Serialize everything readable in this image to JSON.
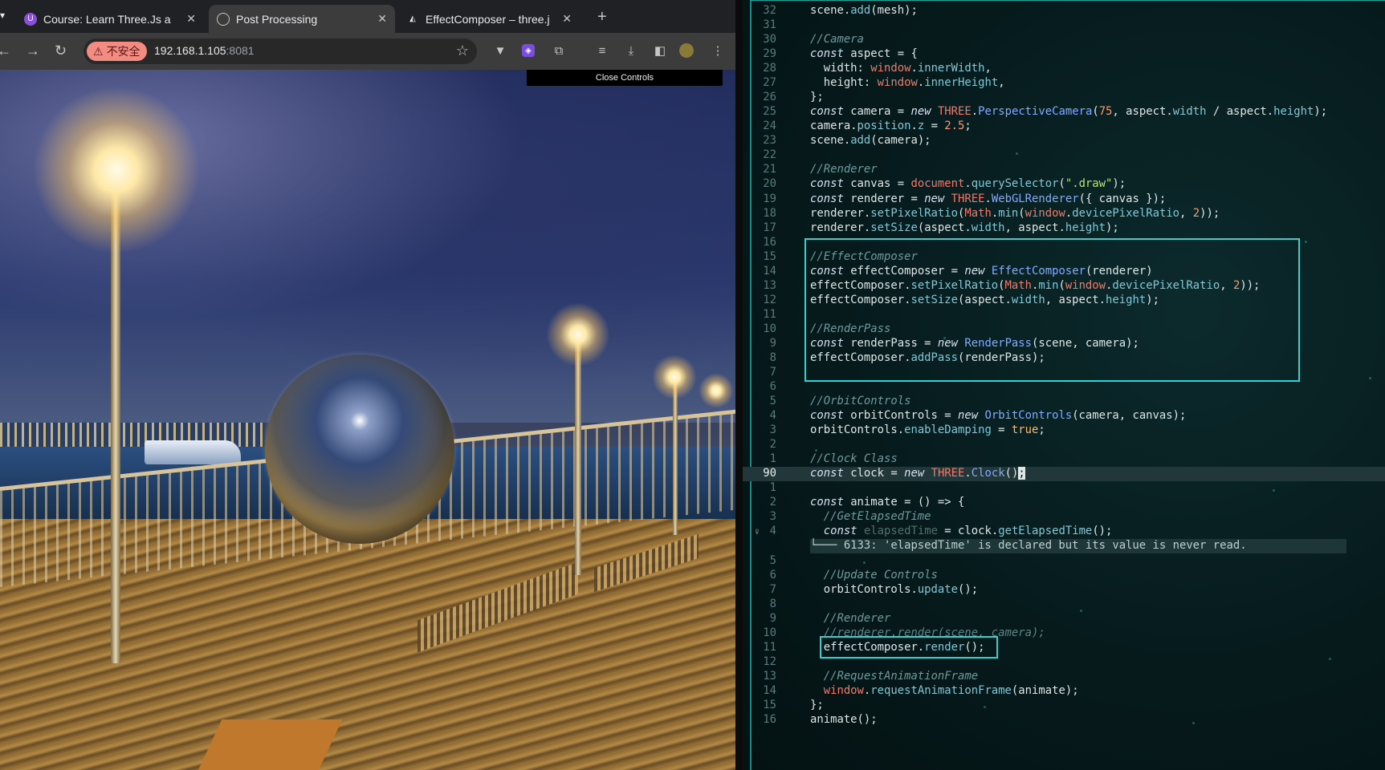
{
  "browser": {
    "tabs": [
      {
        "title": "Course: Learn Three.Js a",
        "favicon": "course-icon"
      },
      {
        "title": "Post Processing",
        "favicon": "globe-icon",
        "active": true
      },
      {
        "title": "EffectComposer – three.j",
        "favicon": "threejs-icon"
      }
    ],
    "address": {
      "security_label": "不安全",
      "host": "192.168.1.105",
      "port": ":8081"
    },
    "page": {
      "close_controls_label": "Close Controls"
    }
  },
  "editor": {
    "diagnostic": "└─── 6133: 'elapsedTime' is declared but its value is never read.",
    "lines": [
      {
        "n": "32",
        "text": "scene.add(mesh);"
      },
      {
        "n": "31",
        "text": ""
      },
      {
        "n": "30",
        "text": "//Camera"
      },
      {
        "n": "29",
        "text": "const aspect = {"
      },
      {
        "n": "28",
        "text": "  width: window.innerWidth,"
      },
      {
        "n": "27",
        "text": "  height: window.innerHeight,"
      },
      {
        "n": "26",
        "text": "};"
      },
      {
        "n": "25",
        "text": "const camera = new THREE.PerspectiveCamera(75, aspect.width / aspect.height);"
      },
      {
        "n": "24",
        "text": "camera.position.z = 2.5;"
      },
      {
        "n": "23",
        "text": "scene.add(camera);"
      },
      {
        "n": "22",
        "text": ""
      },
      {
        "n": "21",
        "text": "//Renderer"
      },
      {
        "n": "20",
        "text": "const canvas = document.querySelector(\".draw\");"
      },
      {
        "n": "19",
        "text": "const renderer = new THREE.WebGLRenderer({ canvas });"
      },
      {
        "n": "18",
        "text": "renderer.setPixelRatio(Math.min(window.devicePixelRatio, 2));"
      },
      {
        "n": "17",
        "text": "renderer.setSize(aspect.width, aspect.height);"
      },
      {
        "n": "16",
        "text": ""
      },
      {
        "n": "15",
        "text": "//EffectComposer"
      },
      {
        "n": "14",
        "text": "const effectComposer = new EffectComposer(renderer)"
      },
      {
        "n": "13",
        "text": "effectComposer.setPixelRatio(Math.min(window.devicePixelRatio, 2));"
      },
      {
        "n": "12",
        "text": "effectComposer.setSize(aspect.width, aspect.height);"
      },
      {
        "n": "11",
        "text": ""
      },
      {
        "n": "10",
        "text": "//RenderPass"
      },
      {
        "n": "9",
        "text": "const renderPass = new RenderPass(scene, camera);"
      },
      {
        "n": "8",
        "text": "effectComposer.addPass(renderPass);"
      },
      {
        "n": "7",
        "text": ""
      },
      {
        "n": "6",
        "text": ""
      },
      {
        "n": "5",
        "text": "//OrbitControls"
      },
      {
        "n": "4",
        "text": "const orbitControls = new OrbitControls(camera, canvas);"
      },
      {
        "n": "3",
        "text": "orbitControls.enableDamping = true;"
      },
      {
        "n": "2",
        "text": ""
      },
      {
        "n": "1",
        "text": "//Clock Class"
      },
      {
        "n": "90",
        "text": "const clock = new THREE.Clock();"
      },
      {
        "n": "1",
        "text": ""
      },
      {
        "n": "2",
        "text": "const animate = () => {"
      },
      {
        "n": "3",
        "text": "  //GetElapsedTime"
      },
      {
        "n": "4",
        "text": "  const elapsedTime = clock.getElapsedTime();"
      },
      {
        "n": "",
        "text": ""
      },
      {
        "n": "5",
        "text": ""
      },
      {
        "n": "6",
        "text": "  //Update Controls"
      },
      {
        "n": "7",
        "text": "  orbitControls.update();"
      },
      {
        "n": "8",
        "text": ""
      },
      {
        "n": "9",
        "text": "  //Renderer"
      },
      {
        "n": "10",
        "text": "  //renderer.render(scene, camera);"
      },
      {
        "n": "11",
        "text": "  effectComposer.render();"
      },
      {
        "n": "12",
        "text": ""
      },
      {
        "n": "13",
        "text": "  //RequestAnimationFrame"
      },
      {
        "n": "14",
        "text": "  window.requestAnimationFrame(animate);"
      },
      {
        "n": "15",
        "text": "};"
      },
      {
        "n": "16",
        "text": "animate();"
      }
    ]
  }
}
